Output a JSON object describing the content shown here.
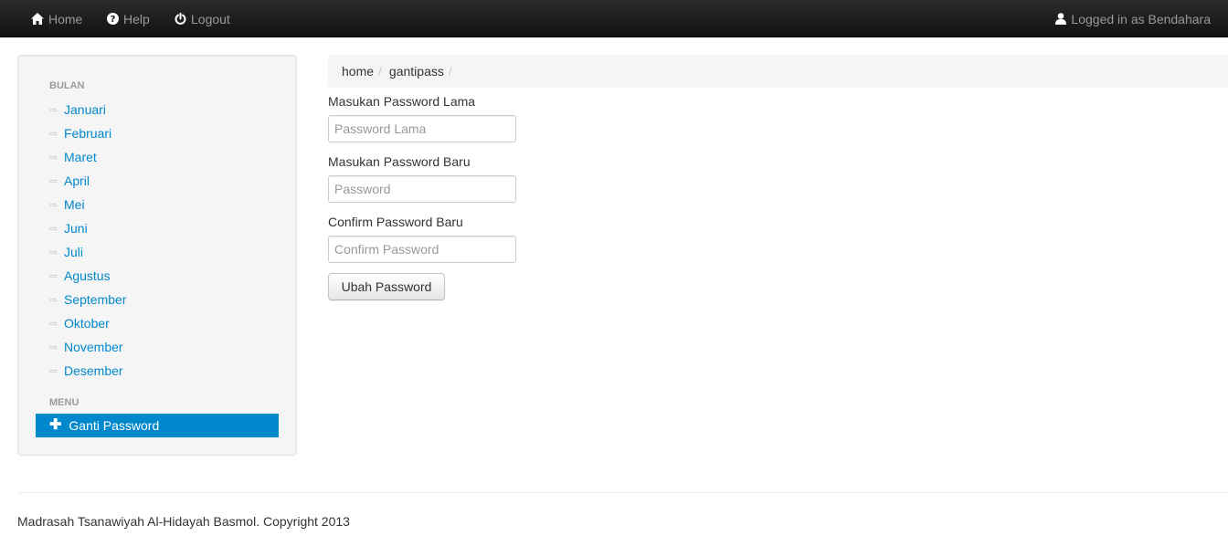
{
  "navbar": {
    "home_label": "Home",
    "help_label": "Help",
    "logout_label": "Logout",
    "user_label": "Logged in as Bendahara"
  },
  "sidebar": {
    "months_header": "BULAN",
    "months": [
      {
        "label": "Januari"
      },
      {
        "label": "Februari"
      },
      {
        "label": "Maret"
      },
      {
        "label": "April"
      },
      {
        "label": "Mei"
      },
      {
        "label": "Juni"
      },
      {
        "label": "Juli"
      },
      {
        "label": "Agustus"
      },
      {
        "label": "September"
      },
      {
        "label": "Oktober"
      },
      {
        "label": "November"
      },
      {
        "label": "Desember"
      }
    ],
    "menu_header": "MENU",
    "menu_active_label": "Ganti Password"
  },
  "breadcrumb": {
    "items": [
      "home",
      "gantipass"
    ],
    "separator": "/"
  },
  "form": {
    "old_label": "Masukan Password Lama",
    "old_placeholder": "Password Lama",
    "new_label": "Masukan Password Baru",
    "new_placeholder": "Password",
    "confirm_label": "Confirm Password Baru",
    "confirm_placeholder": "Confirm Password",
    "submit_label": "Ubah Password"
  },
  "footer": {
    "text": "Madrasah Tsanawiyah Al-Hidayah Basmol. Copyright 2013"
  },
  "colors": {
    "navbar_bg": "#1b1b1b",
    "link": "#0088cc",
    "active_bg": "#0088cc",
    "panel_bg": "#f5f5f5"
  }
}
